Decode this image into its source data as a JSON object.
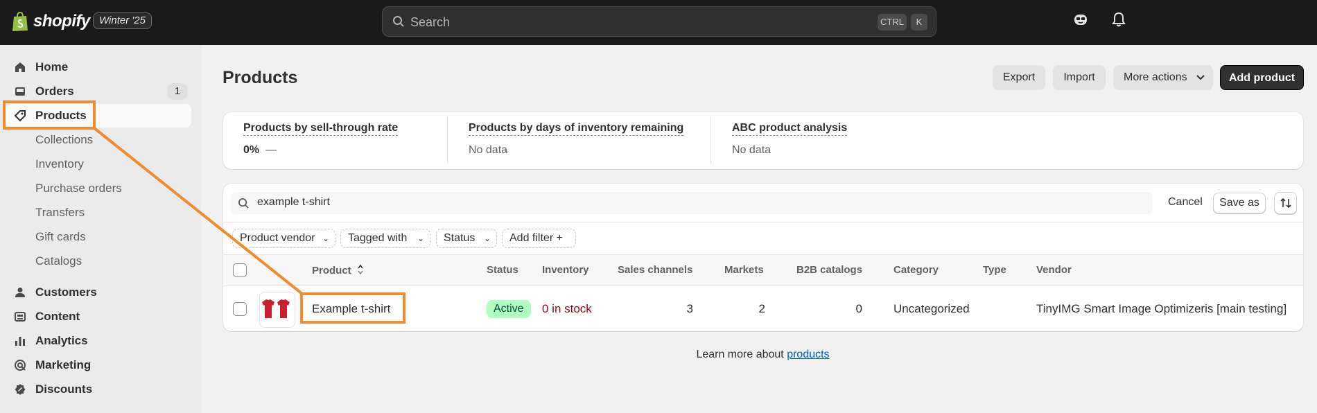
{
  "topbar": {
    "brand": "shopify",
    "edition": "Winter '25",
    "search_placeholder": "Search",
    "shortcut_ctrl": "CTRL",
    "shortcut_k": "K"
  },
  "sidebar": {
    "items": [
      {
        "label": "Home",
        "icon": "home-icon"
      },
      {
        "label": "Orders",
        "icon": "inbox-icon",
        "badge": "1"
      },
      {
        "label": "Products",
        "icon": "tag-icon",
        "active": true
      },
      {
        "label": "Collections",
        "sub": true
      },
      {
        "label": "Inventory",
        "sub": true
      },
      {
        "label": "Purchase orders",
        "sub": true
      },
      {
        "label": "Transfers",
        "sub": true
      },
      {
        "label": "Gift cards",
        "sub": true
      },
      {
        "label": "Catalogs",
        "sub": true
      },
      {
        "label": "Customers",
        "icon": "person-icon"
      },
      {
        "label": "Content",
        "icon": "content-icon"
      },
      {
        "label": "Analytics",
        "icon": "bar-chart-icon"
      },
      {
        "label": "Marketing",
        "icon": "target-icon"
      },
      {
        "label": "Discounts",
        "icon": "discount-icon"
      }
    ]
  },
  "page": {
    "title": "Products",
    "export_label": "Export",
    "import_label": "Import",
    "more_actions_label": "More actions",
    "add_product_label": "Add product"
  },
  "metrics": [
    {
      "title": "Products by sell-through rate",
      "value": "0%",
      "extra": "—"
    },
    {
      "title": "Products by days of inventory remaining",
      "value": "No data"
    },
    {
      "title": "ABC product analysis",
      "value": "No data"
    }
  ],
  "filters": {
    "search_value": "example t-shirt",
    "cancel_label": "Cancel",
    "save_as_label": "Save as",
    "chips": [
      "Product vendor",
      "Tagged with",
      "Status",
      "Add filter +"
    ]
  },
  "table": {
    "headers": [
      "Product",
      "Status",
      "Inventory",
      "Sales channels",
      "Markets",
      "B2B catalogs",
      "Category",
      "Type",
      "Vendor"
    ],
    "rows": [
      {
        "product": "Example t-shirt",
        "status": "Active",
        "inventory": "0 in stock",
        "sales_channels": "3",
        "markets": "2",
        "b2b_catalogs": "0",
        "category": "Uncategorized",
        "type": "",
        "vendor": "TinyIMG Smart Image Optimizeris [main testing]"
      }
    ]
  },
  "footer": {
    "prefix": "Learn more about ",
    "link": "products"
  },
  "colors": {
    "topbar": "#1a1a1a",
    "highlight": "#f28a2e",
    "status_active_bg": "#affebf",
    "inventory_red": "#8e0b21",
    "link_blue": "#005bd3"
  }
}
